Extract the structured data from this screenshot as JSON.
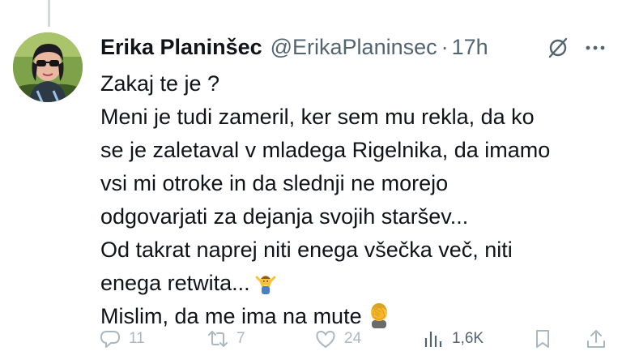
{
  "tweet": {
    "display_name": "Erika Planinšec",
    "handle": "@ErikaPlaninsec",
    "separator": "·",
    "time": "17h",
    "lines": [
      "Zakaj te je ?",
      "Meni je tudi zameril, ker sem mu rekla, da ko",
      "se je zaletaval v mladega Rigelnika, da imamo",
      "vsi mi otroke in da slednji ne morejo",
      "odgovarjati za dejanja svojih staršev...",
      "Od takrat naprej niti enega všečka več, niti",
      "enega retwita...",
      "Mislim, da me ima na mute"
    ],
    "emojis": [
      "person-shrugging-emoji",
      "face-palm-emoji"
    ]
  },
  "actions": {
    "replies": "11",
    "reposts": "7",
    "likes": "24",
    "views": "1,6K"
  },
  "icons": {
    "header": [
      "grok-icon",
      "more-icon"
    ],
    "actions": [
      "reply-icon",
      "repost-icon",
      "like-icon",
      "views-icon",
      "bookmark-icon",
      "share-icon"
    ]
  },
  "colors": {
    "text": "#0f1419",
    "secondary": "#536471",
    "action_faded": "#aab8c2",
    "thread_line": "#cfd9de"
  }
}
